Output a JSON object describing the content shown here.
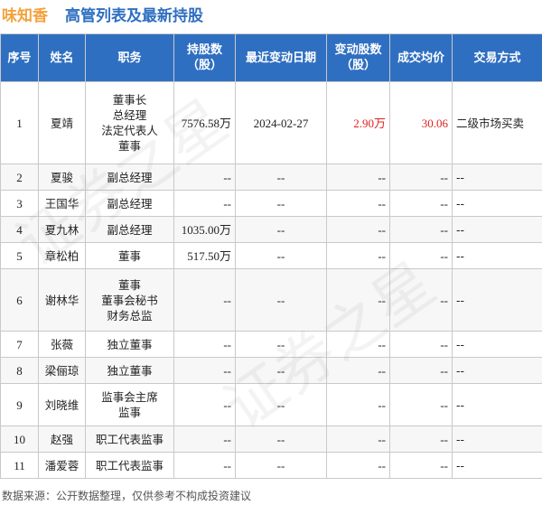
{
  "header": {
    "company": "味知香",
    "title": "高管列表及最新持股"
  },
  "table": {
    "columns": [
      "序号",
      "姓名",
      "职务",
      "持股数（股）",
      "最近变动日期",
      "变动股数（股）",
      "成交均价",
      "交易方式"
    ],
    "rows": [
      {
        "no": "1",
        "name": "夏靖",
        "roles": [
          "董事长",
          "总经理",
          "法定代表人",
          "董事"
        ],
        "shares": "7576.58万",
        "date": "2024-02-27",
        "change": "2.90万",
        "price": "30.06",
        "method": "二级市场买卖"
      },
      {
        "no": "2",
        "name": "夏骏",
        "roles": [
          "副总经理"
        ],
        "shares": "--",
        "date": "--",
        "change": "--",
        "price": "--",
        "method": "--"
      },
      {
        "no": "3",
        "name": "王国华",
        "roles": [
          "副总经理"
        ],
        "shares": "--",
        "date": "--",
        "change": "--",
        "price": "--",
        "method": "--"
      },
      {
        "no": "4",
        "name": "夏九林",
        "roles": [
          "副总经理"
        ],
        "shares": "1035.00万",
        "date": "--",
        "change": "--",
        "price": "--",
        "method": "--"
      },
      {
        "no": "5",
        "name": "章松柏",
        "roles": [
          "董事"
        ],
        "shares": "517.50万",
        "date": "--",
        "change": "--",
        "price": "--",
        "method": "--"
      },
      {
        "no": "6",
        "name": "谢林华",
        "roles": [
          "董事",
          "董事会秘书",
          "财务总监"
        ],
        "shares": "--",
        "date": "--",
        "change": "--",
        "price": "--",
        "method": "--"
      },
      {
        "no": "7",
        "name": "张薇",
        "roles": [
          "独立董事"
        ],
        "shares": "--",
        "date": "--",
        "change": "--",
        "price": "--",
        "method": "--"
      },
      {
        "no": "8",
        "name": "梁俪琼",
        "roles": [
          "独立董事"
        ],
        "shares": "--",
        "date": "--",
        "change": "--",
        "price": "--",
        "method": "--"
      },
      {
        "no": "9",
        "name": "刘晓维",
        "roles": [
          "监事会主席",
          "监事"
        ],
        "shares": "--",
        "date": "--",
        "change": "--",
        "price": "--",
        "method": "--"
      },
      {
        "no": "10",
        "name": "赵强",
        "roles": [
          "职工代表监事"
        ],
        "shares": "--",
        "date": "--",
        "change": "--",
        "price": "--",
        "method": "--"
      },
      {
        "no": "11",
        "name": "潘爱蓉",
        "roles": [
          "职工代表监事"
        ],
        "shares": "--",
        "date": "--",
        "change": "--",
        "price": "--",
        "method": "--"
      }
    ]
  },
  "footer": {
    "source": "数据来源：公开数据整理，仅供参考不构成投资建议"
  },
  "watermark": {
    "text": "证券之星"
  },
  "colors": {
    "brand": "#f4a13c",
    "header_bg": "#2f6fc1",
    "highlight": "#e02020"
  }
}
